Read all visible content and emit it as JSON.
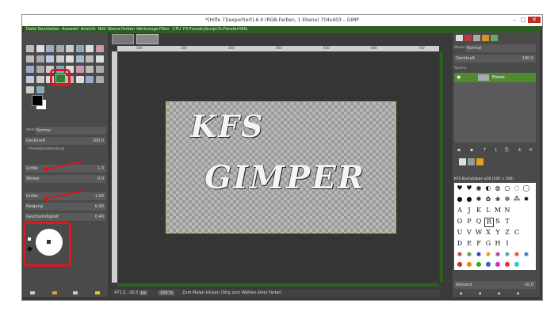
{
  "window": {
    "title": "*[Hilfe 7](exportiert)-6.0 (RGB-Farben, 1 Ebene) 704x403 – GIMP",
    "min": "–",
    "max": "□",
    "close": "✕"
  },
  "menu": [
    "Datei",
    "Bearbeiten",
    "Auswahl",
    "Ansicht",
    "Bild",
    "Ebene",
    "Farben",
    "Werkzeuge",
    "Filter",
    "CFU",
    "FX-Foundry",
    "Script-Fu",
    "Fenster",
    "Hilfe"
  ],
  "tool_options": {
    "modus_label": "Modus:",
    "modus_value": "Normal",
    "deckkraft_label": "Deckkraft",
    "deckkraft_value": "100,0",
    "pinsel_label": "Pinselüberblendung",
    "groesse_label": "Größe",
    "groesse_value": "1,0",
    "winkel_label": "Winkel",
    "winkel_value": "0,0",
    "dyn_groesse_label": "Größe",
    "dyn_groesse_value": "1,00",
    "neigung_label": "Neigung",
    "neigung_value": "0,40",
    "geschw_label": "Geschwindigkeit",
    "geschw_value": "0,40"
  },
  "ruler": [
    "100",
    "200",
    "300",
    "400",
    "500",
    "600",
    "700"
  ],
  "canvas_text": {
    "line1": "KFS",
    "line2": "GIMPER"
  },
  "status": {
    "coords": "471,5, -30,5",
    "unit": "px",
    "zoom": "100 %",
    "message": "Zum Malen klicken (Strg zum Wählen einer Farbe)"
  },
  "layers": {
    "modus_label": "Modus:",
    "modus_value": "Normal",
    "deckkraft_label": "Deckkraft",
    "deckkraft_value": "100,0",
    "sperre_label": "Sperre:",
    "layer_name": "Ebene"
  },
  "brushes": {
    "header": "KFS Buchstaben a18 (100 × 100)",
    "footer_label": "Abstand",
    "footer_value": "10,0"
  },
  "colors": {
    "menubar": "#2f5e22",
    "highlight": "#e0151d",
    "layer_selected": "#4f8a2f"
  }
}
